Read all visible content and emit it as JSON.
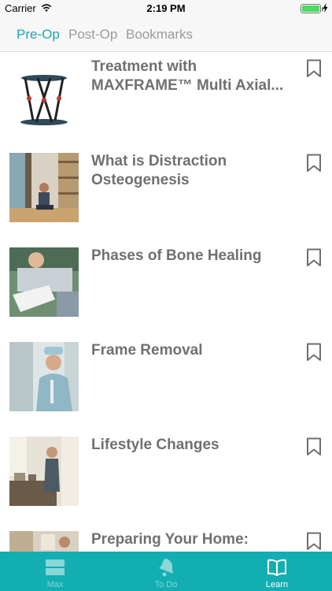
{
  "status": {
    "carrier": "Carrier",
    "time": "2:19 PM"
  },
  "tabs": [
    {
      "label": "Pre-Op",
      "active": true
    },
    {
      "label": "Post-Op",
      "active": false
    },
    {
      "label": "Bookmarks",
      "active": false
    }
  ],
  "items": [
    {
      "title": "Treatment with MAXFRAME™ Multi Axial...",
      "image": "external-fixator-frame"
    },
    {
      "title": "What is Distraction Osteogenesis",
      "image": "man-sitting-in-library"
    },
    {
      "title": "Phases of Bone Healing",
      "image": "patient-with-leg-cast"
    },
    {
      "title": "Frame Removal",
      "image": "smiling-surgeon"
    },
    {
      "title": "Lifestyle Changes",
      "image": "woman-cooking-in-kitchen"
    },
    {
      "title": "Preparing Your Home:",
      "image": "home-interior"
    }
  ],
  "bottom_nav": [
    {
      "label": "Max",
      "icon": "max-icon",
      "active": false
    },
    {
      "label": "To Do",
      "icon": "bell-icon",
      "active": false
    },
    {
      "label": "Learn",
      "icon": "book-icon",
      "active": true
    }
  ],
  "colors": {
    "accent": "#1aa7b0",
    "tab_bar": "#13aeb2",
    "title_text": "#707070",
    "inactive_tab": "#9a9a9a"
  }
}
